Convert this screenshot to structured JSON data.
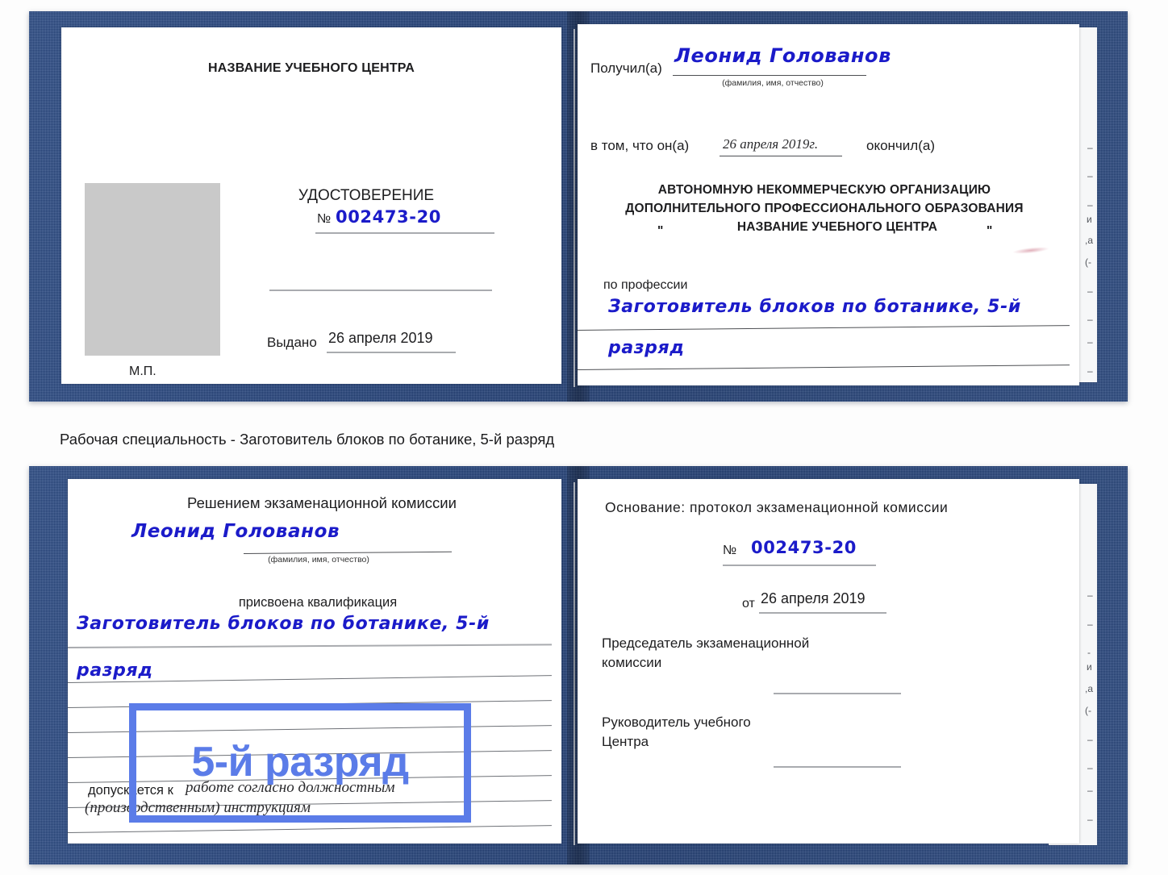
{
  "meta": {
    "accent_blue": "#5b7ce8",
    "ink_blue": "#1b1bc9",
    "cover_navy": "#21407a"
  },
  "caption": {
    "text": "Рабочая специальность - Заготовитель блоков по ботанике, 5-й разряд"
  },
  "annotation": {
    "label": "5-й разряд"
  },
  "cert_top": {
    "left_page": {
      "header": "НАЗВАНИЕ УЧЕБНОГО ЦЕНТРА",
      "doc_type": "УДОСТОВЕРЕНИЕ",
      "number_symbol": "№",
      "number_value": "002473-20",
      "issued_label": "Выдано",
      "issued_value": "26 апреля 2019",
      "seal_label": "М.П.",
      "photo_placeholder": "photo-placeholder"
    },
    "right_page": {
      "received_label": "Получил(а)",
      "received_value": "Леонид Голованов",
      "fio_hint": "(фамилия, имя, отчество)",
      "that_he_label": "в том, что он(а)",
      "completion_date": "26 апреля 2019г.",
      "finished_label": "окончил(а)",
      "org_line1": "АВТОНОМНУЮ НЕКОММЕРЧЕСКУЮ ОРГАНИЗАЦИЮ",
      "org_line2": "ДОПОЛНИТЕЛЬНОГО ПРОФЕССИОНАЛЬНОГО ОБРАЗОВАНИЯ",
      "org_quote_open": "\"",
      "org_name": "НАЗВАНИЕ УЧЕБНОГО ЦЕНТРА",
      "org_quote_close": "\"",
      "profession_label": "по профессии",
      "profession_value_line1": "Заготовитель блоков по ботанике, 5-й",
      "profession_value_line2": "разряд",
      "edge_marks": [
        "–",
        "–",
        "–",
        "и",
        ",а",
        "(-",
        "–",
        "–",
        "–",
        "–"
      ]
    }
  },
  "cert_bottom": {
    "left_page": {
      "decision_title": "Решением экзаменационной комиссии",
      "name_value": "Леонид Голованов",
      "fio_hint": "(фамилия, имя, отчество)",
      "qualification_label": "присвоена квалификация",
      "qualification_line1": "Заготовитель блоков по ботанике, 5-й",
      "qualification_line2": "разряд",
      "allowed_label": "допускается к",
      "allowed_value_line1": "работе согласно должностным",
      "allowed_value_line2": "(производственным) инструкциям"
    },
    "right_page": {
      "basis_label": "Основание: протокол экзаменационной комиссии",
      "number_symbol": "№",
      "number_value": "002473-20",
      "date_label": "от",
      "date_value": "26 апреля 2019",
      "chairman_line1": "Председатель экзаменационной",
      "chairman_line2": "комиссии",
      "head_line1": "Руководитель учебного",
      "head_line2": "Центра",
      "edge_marks": [
        "–",
        "–",
        "-",
        "и",
        ",а",
        "(-",
        "–",
        "–",
        "–",
        "–"
      ]
    }
  }
}
